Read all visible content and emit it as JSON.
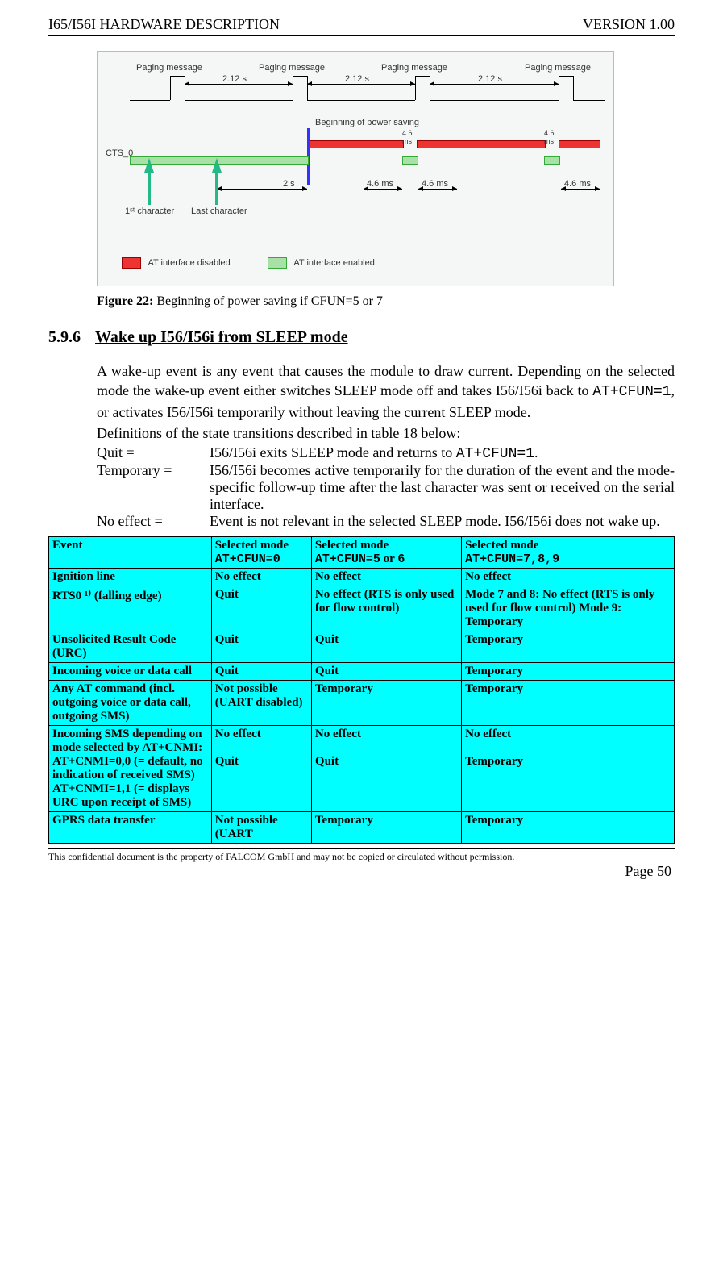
{
  "header": {
    "left": "I65/I56I HARDWARE DESCRIPTION",
    "right": "VERSION 1.00"
  },
  "figure": {
    "labels": {
      "paging1": "Paging message",
      "paging2": "Paging message",
      "paging3": "Paging message",
      "paging4": "Paging message",
      "t212a": "2.12 s",
      "t212b": "2.12 s",
      "t212c": "2.12 s",
      "begin": "Beginning of power saving",
      "cts": "CTS_0",
      "ms46a": "4.6\nms",
      "ms46b": "4.6\nms",
      "t2s": "2 s",
      "t46a": "4.6 ms",
      "t46b": "4.6 ms",
      "t46c": "4.6 ms",
      "firstchar": "1ˢᵗ character",
      "lastchar": "Last character",
      "legend_disabled": "AT interface disabled",
      "legend_enabled": "AT interface enabled"
    }
  },
  "caption": {
    "strong": "Figure 22:",
    "rest": " Beginning of power saving if CFUN=5 or 7"
  },
  "section": {
    "num": "5.9.6",
    "title": "Wake up I56/I56i from SLEEP mode"
  },
  "para1a": "A wake-up event is any event that causes the module to draw current. Depending on the selected mode the wake-up event either switches SLEEP mode off and takes I56/I56i back to ",
  "para1_code": "AT+CFUN=1",
  "para1b": ", or activates I56/I56i temporarily without leaving the current SLEEP mode.",
  "para2": "Definitions of the state transitions described in table 18 below:",
  "defs": {
    "quit_term": "Quit =",
    "quit_a": "I56/I56i exits SLEEP mode and returns to ",
    "quit_code": "AT+CFUN=1",
    "quit_b": ".",
    "temp_term": "Temporary =",
    "temp": "I56/I56i becomes active temporarily for the duration of the event and the mode-specific follow-up time after the last character was sent or received on the serial interface.",
    "noeff_term": "No effect =",
    "noeff": "Event is not relevant in the selected SLEEP mode. I56/I56i does not wake up."
  },
  "table": {
    "head": {
      "c0": "Event",
      "c1a": "Selected mode",
      "c1b": "AT+CFUN=0",
      "c2a": "Selected mode",
      "c2b": "AT+CFUN=5",
      "c2c": " or ",
      "c2d": "6",
      "c3a": "Selected mode",
      "c3b": "AT+CFUN=7,8,9"
    },
    "rows": [
      {
        "c0": "Ignition line",
        "c1": "No effect",
        "c2": "No effect",
        "c3": "No effect"
      },
      {
        "c0": "RTS0 ¹⁾ (falling edge)",
        "c1": "Quit",
        "c2": "No effect (RTS is only used for flow control)",
        "c3": "Mode 7 and 8: No effect (RTS is only used for flow control) Mode 9: Temporary"
      },
      {
        "c0": "Unsolicited Result Code (URC)",
        "c1": "Quit",
        "c2": "Quit",
        "c3": "Temporary"
      },
      {
        "c0": "Incoming voice or data call",
        "c1": "Quit",
        "c2": "Quit",
        "c3": "Temporary"
      },
      {
        "c0": "Any AT command (incl. outgoing voice or data call, outgoing SMS)",
        "c1": "Not possible (UART disabled)",
        "c2": "Temporary",
        "c3": "Temporary"
      },
      {
        "c0": "Incoming SMS depending on mode selected by AT+CNMI: AT+CNMI=0,0 (= default, no indication of received SMS) AT+CNMI=1,1 (= displays URC upon receipt of SMS)",
        "c1": "No effect\n\nQuit",
        "c2": "No effect\n\nQuit",
        "c3": "No effect\n\nTemporary"
      },
      {
        "c0": "GPRS data transfer",
        "c1": "Not possible (UART",
        "c2": "Temporary",
        "c3": "Temporary"
      }
    ]
  },
  "footer": {
    "conf": "This confidential document is the property of FALCOM GmbH and may not be copied or circulated without permission.",
    "page": "Page 50"
  }
}
